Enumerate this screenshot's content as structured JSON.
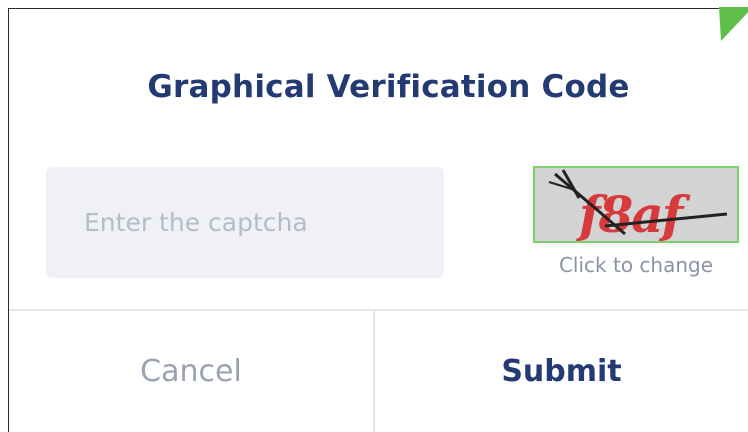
{
  "dialog": {
    "title": "Graphical Verification Code",
    "input": {
      "placeholder": "Enter the captcha",
      "value": ""
    },
    "captcha": {
      "code": "f8af",
      "change_label": "Click to change",
      "text_color": "#d63a3a",
      "border_color": "#7ccf6a"
    },
    "buttons": {
      "cancel_label": "Cancel",
      "submit_label": "Submit"
    }
  },
  "colors": {
    "title": "#243a73",
    "submit": "#243a73",
    "cancel": "#9aa2b3",
    "input_background": "#eff1f6",
    "corner_accent": "#5fbf4a"
  }
}
